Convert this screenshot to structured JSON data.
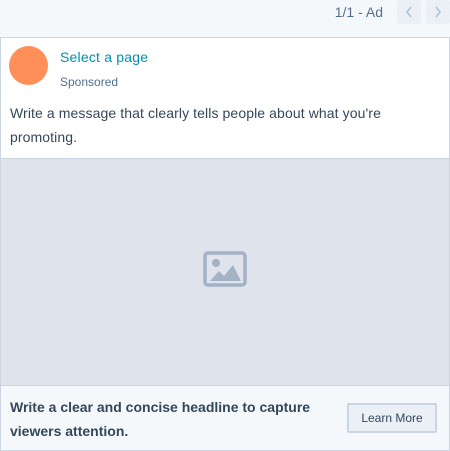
{
  "pager": {
    "label": "1/1 - Ad",
    "prev_icon": "chevron-left-icon",
    "next_icon": "chevron-right-icon"
  },
  "ad": {
    "page_link": "Select a page",
    "sponsored": "Sponsored",
    "message": "Write a message that clearly tells people about what you're promoting.",
    "media_icon": "image-placeholder-icon",
    "headline": "Write a clear and concise headline to capture viewers attention.",
    "cta_label": "Learn More"
  },
  "colors": {
    "avatar": "#ff8f59",
    "link": "#0091ae",
    "media_background": "#dfe3eb",
    "border": "#cbd6e2"
  }
}
